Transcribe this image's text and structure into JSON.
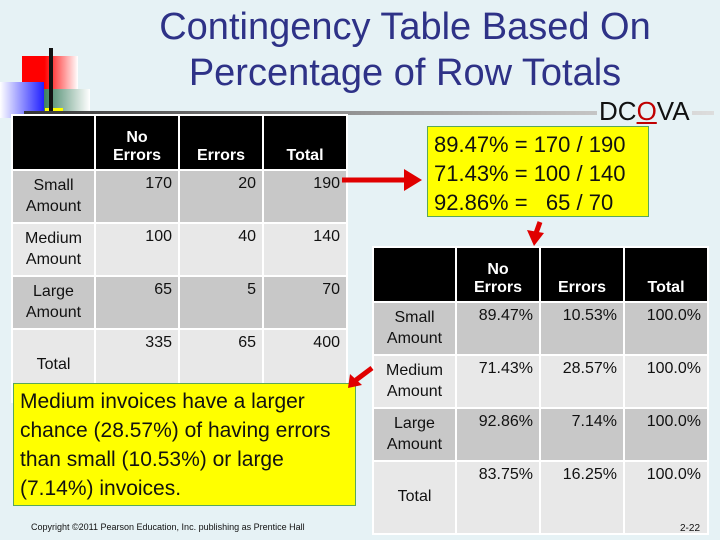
{
  "slide": {
    "title": "Contingency Table Based On Percentage of Row Totals",
    "title_line1": "Contingency Table Based On",
    "title_line2": "Percentage of Row Totals",
    "tag": {
      "prefix": "DC",
      "highlight": "O",
      "suffix": "VA"
    },
    "colors": {
      "title": "#2e3287",
      "highlight": "#c00000",
      "callout_bg": "#ffff00",
      "arrow": "#e00000"
    }
  },
  "counts_table": {
    "headers": [
      "",
      "No Errors",
      "Errors",
      "Total"
    ],
    "rows": [
      {
        "label": "Small Amount",
        "values": [
          "170",
          "20",
          "190"
        ]
      },
      {
        "label": "Medium Amount",
        "values": [
          "100",
          "40",
          "140"
        ]
      },
      {
        "label": "Large Amount",
        "values": [
          "65",
          "5",
          "70"
        ]
      },
      {
        "label": "Total",
        "values": [
          "335",
          "65",
          "400"
        ]
      }
    ]
  },
  "percent_table": {
    "headers": [
      "",
      "No Errors",
      "Errors",
      "Total"
    ],
    "rows": [
      {
        "label": "Small Amount",
        "values": [
          "89.47%",
          "10.53%",
          "100.0%"
        ]
      },
      {
        "label": "Medium Amount",
        "values": [
          "71.43%",
          "28.57%",
          "100.0%"
        ]
      },
      {
        "label": "Large Amount",
        "values": [
          "92.86%",
          "7.14%",
          "100.0%"
        ]
      },
      {
        "label": "Total",
        "values": [
          "83.75%",
          "16.25%",
          "100.0%"
        ]
      }
    ]
  },
  "calc_callout": {
    "lines": [
      "89.47% = 170 / 190",
      "71.43% = 100 / 140",
      "92.86% =   65 / 70"
    ]
  },
  "insight_callout": {
    "text": "Medium invoices have a larger chance (28.57%) of having errors than small (10.53%) or large (7.14%) invoices."
  },
  "footer": {
    "copyright": "Copyright ©2011 Pearson Education, Inc. publishing as Prentice Hall",
    "page_number": "2-22"
  }
}
